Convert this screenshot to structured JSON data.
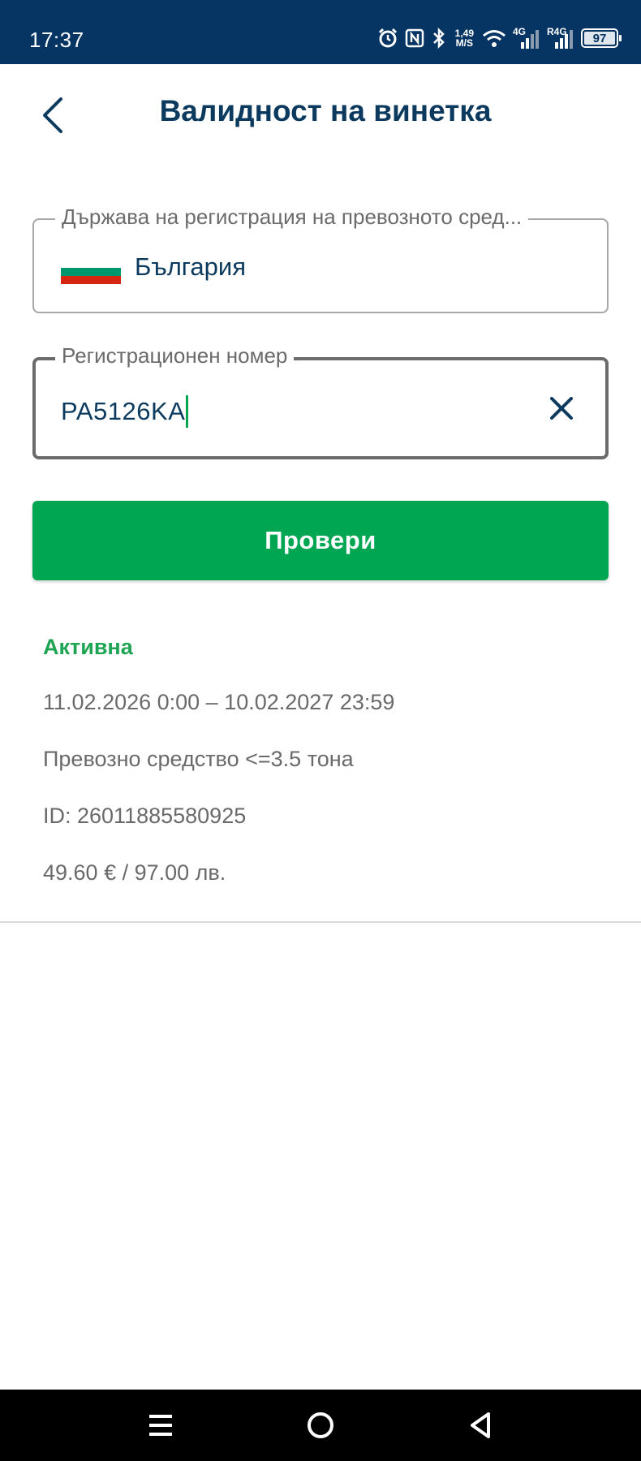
{
  "status_bar": {
    "time": "17:37",
    "speed_value": "1,49",
    "speed_unit": "M/S",
    "network_1": "4G",
    "network_2": "R4G",
    "battery": "97",
    "icons": [
      "alarm-icon",
      "nfc-icon",
      "bluetooth-icon",
      "wifi-icon",
      "signal-icon",
      "signal-icon",
      "battery-icon"
    ]
  },
  "header": {
    "title": "Валидност на винетка",
    "back_icon": "chevron-left-icon"
  },
  "form": {
    "country_label": "Държава на регистрация на превозното сред...",
    "country_value": "България",
    "flag_colors": [
      "#ffffff",
      "#00966e",
      "#d62612"
    ],
    "plate_label": "Регистрационен номер",
    "plate_value": "PA5126KA",
    "clear_icon": "close-icon",
    "submit_label": "Провери"
  },
  "result": {
    "status": "Активна",
    "validity": "11.02.2026 0:00 – 10.02.2027 23:59",
    "vehicle": "Превозно средство <=3.5 тона",
    "id": "ID: 26011885580925",
    "price": "49.60 € / 97.00 лв."
  },
  "colors": {
    "status_bar": "#063564",
    "primary_text": "#0b3a5e",
    "accent_green": "#00a651",
    "active_green": "#1ea554"
  },
  "nav_bar": {
    "icons": [
      "menu-icon",
      "home-circle-icon",
      "back-triangle-icon"
    ]
  }
}
